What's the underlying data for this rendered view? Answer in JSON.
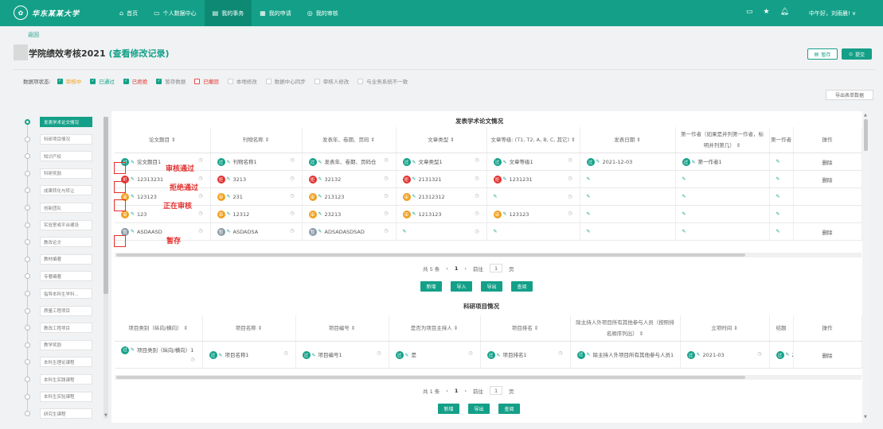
{
  "header": {
    "logo_text": "华东某某大学",
    "nav": [
      {
        "icon": "home-icon",
        "glyph": "⌂",
        "label": "首页"
      },
      {
        "icon": "user-card-icon",
        "glyph": "▭",
        "label": "个人数据中心"
      },
      {
        "icon": "doc-icon",
        "glyph": "▤",
        "label": "我的事务"
      },
      {
        "icon": "apply-icon",
        "glyph": "▦",
        "label": "我的申请"
      },
      {
        "icon": "audit-icon",
        "glyph": "◎",
        "label": "我的审核"
      }
    ],
    "greeting": "中午好，刘雨晨! ∨",
    "icons": [
      "screen-icon",
      "star-icon",
      "bell-icon"
    ]
  },
  "page": {
    "back_label": "返回",
    "title": "学院绩效考核2021",
    "title_link": "(查看修改记录)",
    "save_label": "暂存",
    "submit_label": "提交",
    "export_label": "导出表单数据"
  },
  "legend": {
    "prefix": "数据项状态:",
    "items": [
      {
        "label": "审核中",
        "state": "on",
        "color": "#f0a020"
      },
      {
        "label": "已通过",
        "state": "on",
        "color": "#14a088"
      },
      {
        "label": "已拒绝",
        "state": "on",
        "color": "#e2302d"
      },
      {
        "label": "暂存数据",
        "state": "on",
        "color": "#888888"
      },
      {
        "label": "已撤回",
        "state": "red",
        "color": "#e2302d"
      },
      {
        "label": "本地修改",
        "state": "off",
        "color": "#888888"
      },
      {
        "label": "数据中心同步",
        "state": "off",
        "color": "#888888"
      },
      {
        "label": "审核人修改",
        "state": "off",
        "color": "#888888"
      },
      {
        "label": "与业务系统不一致",
        "state": "off",
        "color": "#888888"
      }
    ]
  },
  "sidebar": {
    "items": [
      "发表学术论文情况",
      "科研项目情况",
      "知识产权",
      "科研奖励",
      "成果转化与转让",
      "创新团队",
      "实验室或平台建设",
      "教改论文",
      "教材编著",
      "专著编著",
      "指导本科生学科...",
      "质量工程项目",
      "教改工程项目",
      "教学奖励",
      "本科生理论课程",
      "本科生实践课程",
      "本科生实验课程",
      "研究生课程"
    ],
    "active_index": 0
  },
  "section1": {
    "title": "发表学术论文情况",
    "headers": [
      "论文题目 ⇕",
      "刊物名称 ⇕",
      "发表年、卷期、页码 ⇕",
      "文章类型 ⇕",
      "文章等级: (T1, T2, A, B, C, 其它) ⇕",
      "发表日期 ⇕",
      "第一作者（如果是并列第一作者，标明并列第几） ⇕",
      "第一作者",
      "操作"
    ],
    "rows": [
      {
        "status": "g",
        "glyph": "过",
        "cells": [
          "论文题目1",
          "刊物名称1",
          "发表年、卷期、页码仓",
          "文章类型1",
          "文章等级1",
          "2021-12-03",
          "第一作者1",
          ""
        ],
        "annot": "审核通过",
        "op": "删除"
      },
      {
        "status": "r",
        "glyph": "拒",
        "cells": [
          "12313231",
          "3213",
          "32132",
          "2131321",
          "1231231",
          "",
          "",
          ""
        ],
        "annot": "拒绝通过",
        "op": "删除"
      },
      {
        "status": "o",
        "glyph": "审",
        "cells": [
          "123123",
          "231",
          "213123",
          "21312312",
          "",
          "",
          "",
          ""
        ],
        "annot": "正在审核",
        "op": ""
      },
      {
        "status": "o",
        "glyph": "审",
        "cells": [
          "123",
          "12312",
          "23213",
          "1213123",
          "123123",
          "",
          "",
          ""
        ],
        "annot": "",
        "op": ""
      },
      {
        "status": "s",
        "glyph": "暂",
        "cells": [
          "ASDAASD",
          "ASDADSA",
          "ADSADASDSAD",
          "",
          "",
          "",
          "",
          ""
        ],
        "annot": "暂存",
        "op": "删除"
      }
    ],
    "pager": {
      "total": "共 5 条",
      "page": "1",
      "goto": "前往",
      "goto_val": "1",
      "page_unit": "页"
    },
    "buttons": [
      "新增",
      "导入",
      "导出",
      "查阅"
    ]
  },
  "section2": {
    "title": "科研项目情况",
    "headers": [
      "项目类别（纵向/横向） ⇕",
      "项目名称 ⇕",
      "项目编号 ⇕",
      "是否为项目主持人 ⇕",
      "项目排名 ⇕",
      "除主持人外项目所有其他参与人员（按照排名顺序列出） ⇕",
      "立项时间 ⇕",
      "结题",
      "操作"
    ],
    "row": {
      "status": "g",
      "glyph": "过",
      "cells": [
        "项目类别（纵向/横向）1",
        "项目名称1",
        "项目编号1",
        "是",
        "项目排名1",
        "除主持人外项目所有其他参与人员1",
        "2021-03",
        "2021"
      ],
      "op": "删除"
    },
    "pager": {
      "total": "共 1 条",
      "page": "1",
      "goto": "前往",
      "goto_val": "1",
      "page_unit": "页"
    },
    "buttons": [
      "新增",
      "导出",
      "查阅"
    ]
  }
}
